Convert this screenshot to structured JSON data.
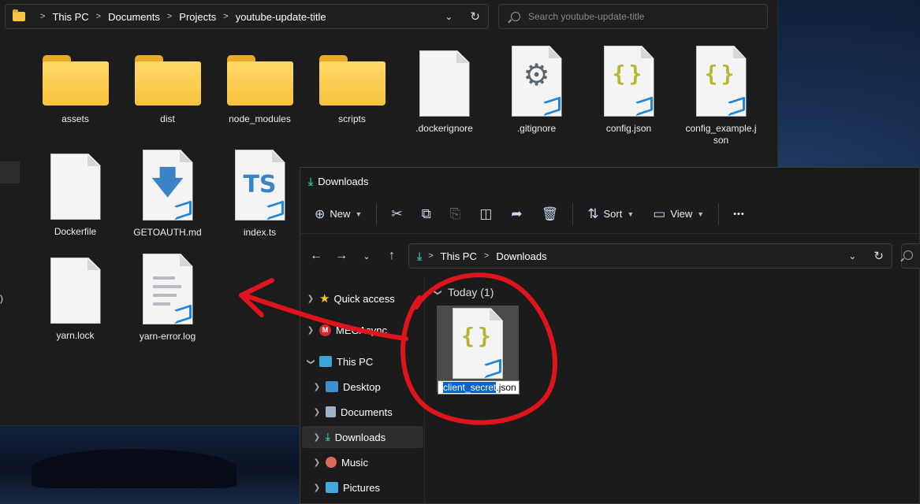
{
  "background_window": {
    "breadcrumb": [
      "This PC",
      "Documents",
      "Projects",
      "youtube-update-title"
    ],
    "search_placeholder": "Search youtube-update-title",
    "nav_fragment": ")",
    "items": [
      {
        "name": "assets",
        "type": "folder"
      },
      {
        "name": "dist",
        "type": "folder"
      },
      {
        "name": "node_modules",
        "type": "folder"
      },
      {
        "name": "scripts",
        "type": "folder"
      },
      {
        "name": ".dockerignore",
        "type": "file"
      },
      {
        "name": ".gitignore",
        "type": "gear-file"
      },
      {
        "name": "config.json",
        "type": "json"
      },
      {
        "name": "config_example.json",
        "label_line1": "config_example.j",
        "label_line2": "son",
        "type": "json"
      },
      {
        "name": "Dockerfile",
        "type": "file"
      },
      {
        "name": "GETOAUTH.md",
        "type": "markdown"
      },
      {
        "name": "index.ts",
        "type": "typescript",
        "badge_text": "TS"
      },
      {
        "name": "yarn.lock",
        "type": "file"
      },
      {
        "name": "yarn-error.log",
        "type": "log"
      }
    ]
  },
  "downloads_window": {
    "title": "Downloads",
    "toolbar": {
      "new_label": "New",
      "sort_label": "Sort",
      "view_label": "View",
      "more_label": "•••"
    },
    "breadcrumb": [
      "This PC",
      "Downloads"
    ],
    "sidebar": [
      {
        "label": "Quick access",
        "icon": "star-icon",
        "expanded": false
      },
      {
        "label": "MEGAsync",
        "icon": "mega-icon",
        "expanded": false
      },
      {
        "label": "This PC",
        "icon": "computer-icon",
        "expanded": true
      },
      {
        "label": "Desktop",
        "icon": "desktop-icon"
      },
      {
        "label": "Documents",
        "icon": "documents-icon"
      },
      {
        "label": "Downloads",
        "icon": "download-icon",
        "selected": true
      },
      {
        "label": "Music",
        "icon": "music-icon"
      },
      {
        "label": "Pictures",
        "icon": "pictures-icon"
      }
    ],
    "group_header": "Today (1)",
    "file": {
      "name": "client_secret.json",
      "rename_selected": "client_secret",
      "rename_rest": ".json"
    }
  },
  "colors": {
    "annotation": "#e0141c",
    "folder": "#f7c23d",
    "vscode_blue": "#1f86d8",
    "selection": "#0a64c8"
  }
}
